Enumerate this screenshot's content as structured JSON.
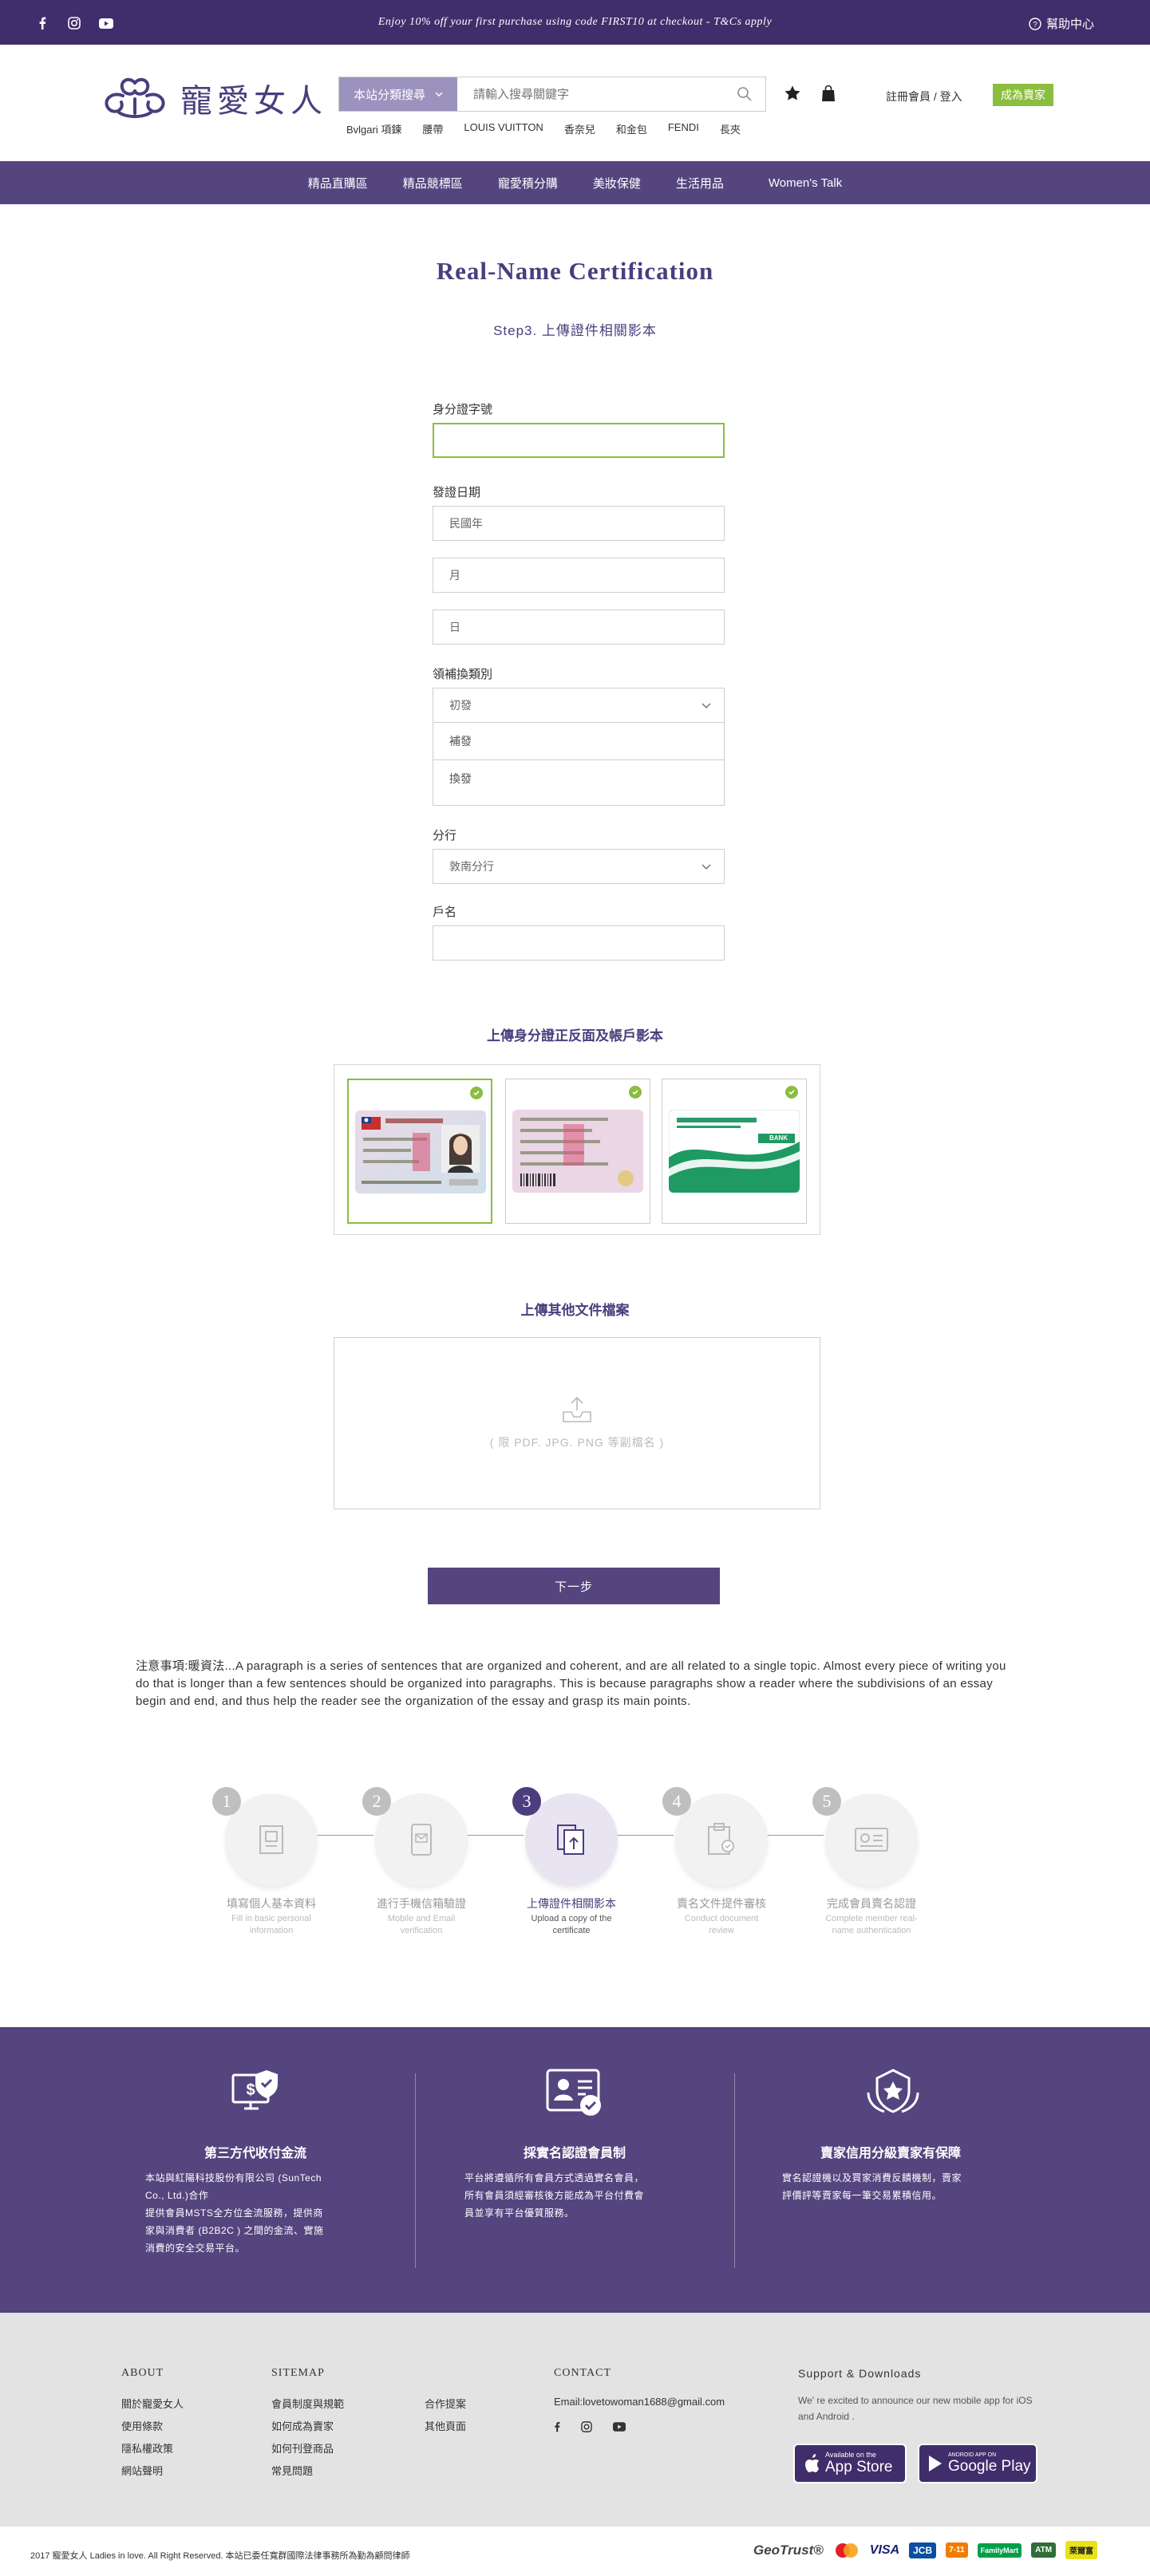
{
  "topbar": {
    "promo": "Enjoy 10% off your first purchase using code FIRST10 at checkout - T&Cs apply",
    "help": "幫助中心",
    "social": [
      "facebook-icon",
      "instagram-icon",
      "youtube-icon"
    ]
  },
  "header": {
    "logo_text": "寵愛女人",
    "search_category": "本站分類搜尋",
    "search_placeholder": "請輸入搜尋關鍵字",
    "hotwords": [
      "Bvlgari 項鍊",
      "腰帶",
      "LOUIS VUITTON",
      "香奈兒",
      "和金包",
      "FENDI",
      "長夾"
    ],
    "login": "註冊會員 / 登入",
    "seller": "成為賣家"
  },
  "nav": [
    "精品直購區",
    "精品競標區",
    "寵愛積分購",
    "美妝保健",
    "生活用品",
    "Women's Talk"
  ],
  "form": {
    "title": "Real-Name Certification",
    "step": "Step3. 上傳證件相關影本",
    "id_label": "身分證字號",
    "date_label": "發證日期",
    "year_placeholder": "民國年",
    "month_placeholder": "月",
    "day_placeholder": "日",
    "type_label": "領補換類別",
    "type_selected": "初發",
    "type_options": [
      "補發",
      "換發"
    ],
    "branch_label": "分行",
    "branch_selected": "敦南分行",
    "account_label": "戶名"
  },
  "upload": {
    "id_title": "上傳身分證正反面及帳戶影本",
    "bank_label": "BANK",
    "other_title": "上傳其他文件檔案",
    "other_hint": "( 限 PDF. JPG. PNG 等副檔名 )",
    "next": "下一步"
  },
  "notice": "注意事項:暖資法...A paragraph is a series of sentences that are organized and coherent, and are all related to a single topic. Almost every piece of writing you do that is longer than a few sentences should be organized into paragraphs. This is because paragraphs show a reader where the subdivisions of an essay begin and end, and thus help the reader see the organization of the essay and grasp its main points.",
  "steps": [
    {
      "num": "1",
      "zh": "填寫個人基本資料",
      "en": "Fill in basic personal information"
    },
    {
      "num": "2",
      "zh": "進行手機信箱驗證",
      "en": "Mobile and Email verification"
    },
    {
      "num": "3",
      "zh": "上傳證件相關影本",
      "en": "Upload a copy of the certificate"
    },
    {
      "num": "4",
      "zh": "賣名文件提件審核",
      "en": "Conduct document review"
    },
    {
      "num": "5",
      "zh": "完成會員賣名認證",
      "en": "Complete member real-name authentication"
    }
  ],
  "band": [
    {
      "title": "第三方代收付金流",
      "text": "本站與紅陽科技股份有限公司 (SunTech Co., Ltd.)合作\n提供會員MSTS全方位金流服務，提供商家與消費者 (B2B2C ) 之間的金流、實施消費的安全交易平台。"
    },
    {
      "title": "採實名認證會員制",
      "text": "平台將遵循所有會員方式透過實名會員，所有會員須經審核後方能成為平台付費會員並享有平台優質服務。"
    },
    {
      "title": "賣家信用分級賣家有保障",
      "text": "實名認證機以及買家消費反饋機制，賣家評價評等賣家每一筆交易累積信用。"
    }
  ],
  "footer": {
    "about_title": "ABOUT",
    "about_links": [
      "關於寵愛女人",
      "使用條款",
      "隱私權政策",
      "網站聲明"
    ],
    "sitemap_title": "SITEMAP",
    "sitemap_col1": [
      "會員制度與規範",
      "如何成為賣家",
      "如何刊登商品",
      "常見問題"
    ],
    "sitemap_col2": [
      "合作提案",
      "其他頁面"
    ],
    "contact_title": "CONTACT",
    "email": "Email:lovetowoman1688@gmail.com",
    "support_title": "Support & Downloads",
    "support_text": "We' re excited to announce our new mobile app for iOS and Android .",
    "appstore_small": "Available on the",
    "appstore_big": "App Store",
    "googleplay_small": "ANDROID APP ON",
    "googleplay_big": "Google Play",
    "copyright": "2017 寵愛女人 Ladies in love. All Right Reserved.    本站已委任寬群國際法律事務所為勤為顧問律師",
    "payments": [
      "GeoTrust®",
      "mastercard",
      "VISA",
      "JCB",
      "7-11",
      "FamilyMart",
      "ATM",
      "萊爾富"
    ]
  },
  "colors": {
    "brand": "#54457f",
    "dark": "#3f2e6b",
    "accent": "#8bbd3f",
    "light_purple": "#9b92bd"
  }
}
